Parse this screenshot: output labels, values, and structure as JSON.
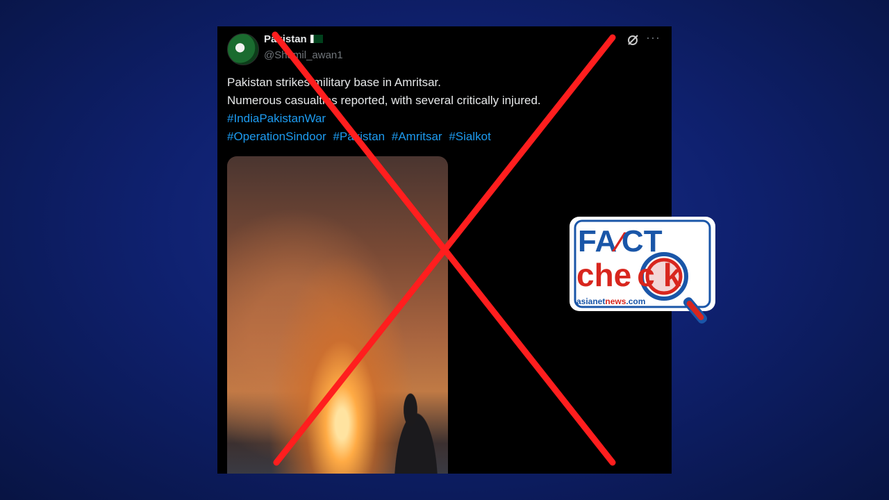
{
  "tweet": {
    "display_name": "Pakistan",
    "handle": "@Shamil_awan1",
    "lines": [
      "Pakistan strikes military base in Amritsar.",
      "Numerous casualties reported, with several critically injured."
    ],
    "hashtags_line1": [
      "#IndiaPakistanWar"
    ],
    "hashtags_line2": [
      "#OperationSindoor",
      "#Pakistan",
      "#Amritsar",
      "#Sialkot"
    ],
    "icons": {
      "grok": "grok-icon",
      "more": "more-options-icon",
      "flag": "pakistan-flag-icon"
    }
  },
  "badge": {
    "word1_part1": "FA",
    "word1_part2": "CT",
    "word2_part1": "che",
    "word2_part2": "k",
    "source_part1": "asianet",
    "source_part2": "news",
    "source_part3": ".com"
  },
  "colors": {
    "background": "#0f2170",
    "cross": "#ff1e1e",
    "link": "#1d9bf0",
    "badge_blue": "#1a56a8",
    "badge_red": "#d8261e"
  }
}
